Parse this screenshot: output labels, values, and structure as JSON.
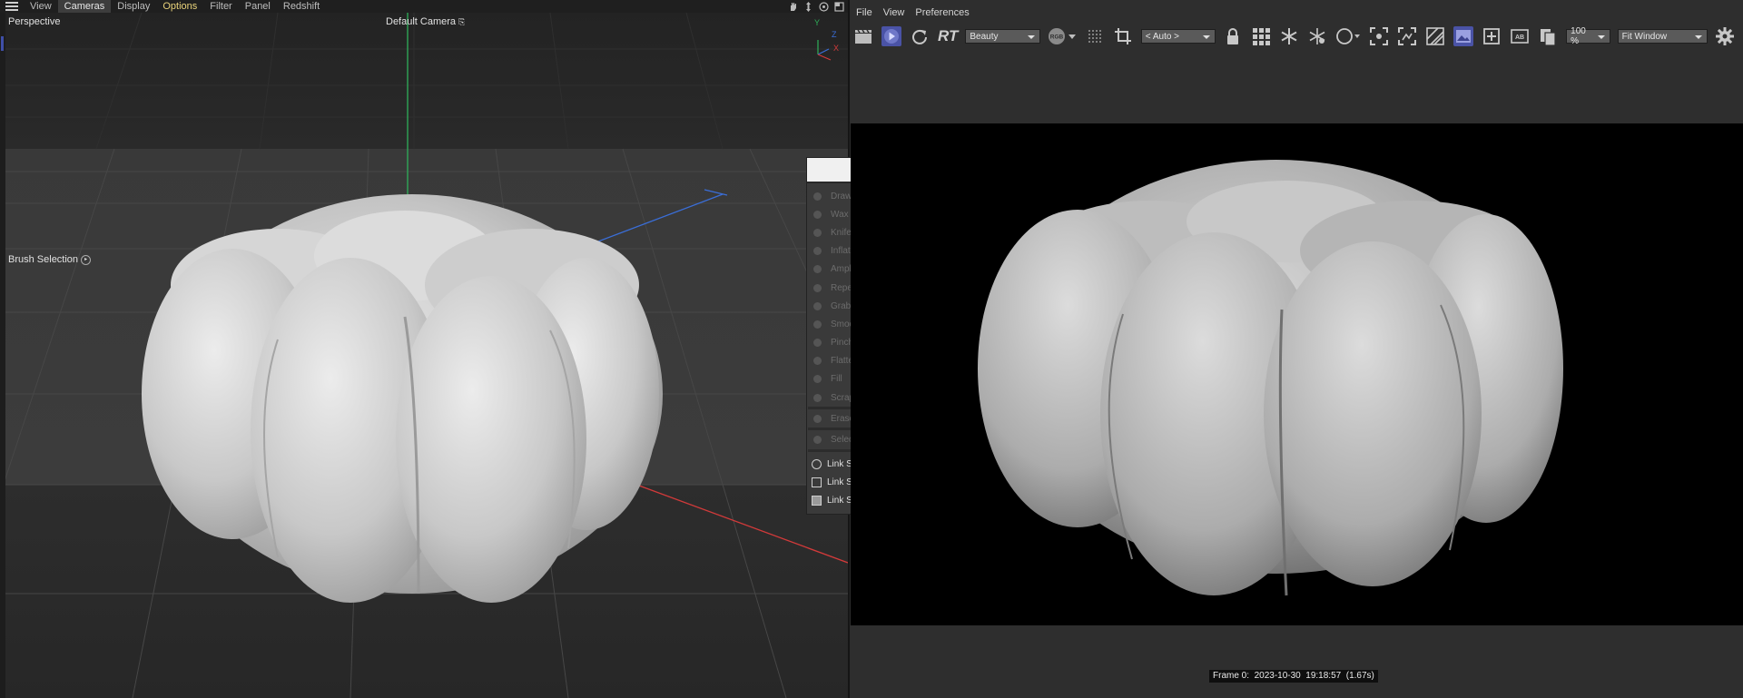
{
  "left_viewport": {
    "menu": [
      "View",
      "Cameras",
      "Display",
      "Options",
      "Filter",
      "Panel",
      "Redshift"
    ],
    "view_label": "Perspective",
    "camera_label": "Default Camera",
    "brush_selection_label": "Brush Selection",
    "axis_letters": {
      "x": "X",
      "y": "Y",
      "z": "Z"
    },
    "tool_icons": [
      "hand-icon",
      "move-icon",
      "camera-rotate-icon",
      "maximize-icon"
    ]
  },
  "brush_panel": {
    "brushes": [
      "Draw",
      "Wax",
      "Knife",
      "Inflate",
      "Amplify",
      "Repeat",
      "Grab",
      "Smooth",
      "Pinch",
      "Flatten",
      "Fill",
      "Scrape"
    ],
    "erase": "Erase",
    "select": "Select",
    "links": [
      "Link Size",
      "Link Strength",
      "Link Stencil"
    ]
  },
  "picture_viewer": {
    "menu": [
      "File",
      "View",
      "Preferences"
    ],
    "rt_label": "RT",
    "aov_select": "Beauty",
    "camera_select": "< Auto >",
    "zoom_value": "100 %",
    "fit_select": "Fit Window",
    "status": "Frame 0:  2023-10-30  19:18:57  (1.67s)",
    "toolbar_icons": [
      "clapper-icon",
      "play-icon",
      "refresh-icon",
      "rgb-icon",
      "grid-dots-icon",
      "crop-icon",
      "lock-icon",
      "grid-icon",
      "snowflake-icon",
      "snowflake-settings-icon",
      "circle-icon",
      "focus-icon",
      "region-icon",
      "stripes-icon",
      "image-icon",
      "add-snapshot-icon",
      "compare-icon",
      "copy-icon",
      "gear-icon"
    ]
  },
  "colors": {
    "accent": "#4a53a6",
    "axis_x": "#d23a3a",
    "axis_y": "#2fb05a",
    "axis_z": "#3a6ed8",
    "options_menu": "#e8d27a"
  }
}
